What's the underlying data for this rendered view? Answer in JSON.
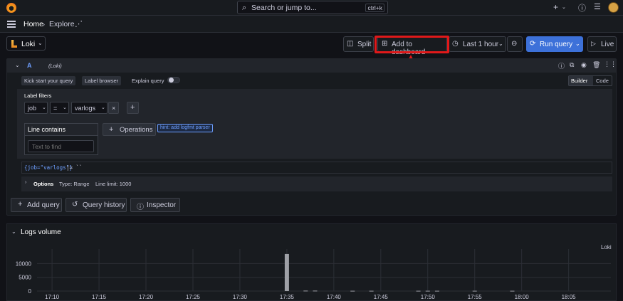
{
  "topbar": {
    "search_placeholder": "Search or jump to...",
    "search_shortcut": "ctrl+k",
    "plus_icon": "plus-icon",
    "help_icon": "help-icon",
    "news_icon": "rss-icon"
  },
  "breadcrumb": {
    "home": "Home",
    "explore": "Explore"
  },
  "toolbar": {
    "datasource": "Loki",
    "split": "Split",
    "add_to_dashboard": "Add to dashboard",
    "time_range": "Last 1 hour",
    "run_query": "Run query",
    "live": "Live"
  },
  "query": {
    "ref_id": "A",
    "datasource_label": "(Loki)",
    "kick_start": "Kick start your query",
    "label_browser": "Label browser",
    "explain_query": "Explain query",
    "mode_builder": "Builder",
    "mode_code": "Code",
    "label_filters_title": "Label filters",
    "filter_label": "job",
    "filter_op": "=",
    "filter_value": "varlogs",
    "line_contains_title": "Line contains",
    "line_contains_placeholder": "Text to find",
    "operations": "Operations",
    "hint": "hint: add logfmt parser",
    "raw_query_1": "{job=\"varlogs\"}",
    "raw_query_2": " |= ``",
    "options_title": "Options",
    "options_type": "Type: Range",
    "options_limit": "Line limit: 1000"
  },
  "bottom_buttons": {
    "add_query": "Add query",
    "query_history": "Query history",
    "inspector": "Inspector"
  },
  "logs_volume": {
    "title": "Logs volume",
    "legend": "Loki"
  },
  "chart_data": {
    "type": "bar",
    "title": "Logs volume",
    "categories": [
      "17:10",
      "17:15",
      "17:20",
      "17:25",
      "17:30",
      "17:35",
      "17:40",
      "17:45",
      "17:50",
      "17:55",
      "18:00",
      "18:05"
    ],
    "yticks": [
      "10000",
      "5000",
      "0"
    ],
    "ylim": [
      0,
      14000
    ],
    "series": [
      {
        "name": "Loki",
        "points": [
          {
            "t": "17:35",
            "value": 13500
          },
          {
            "t": "17:37",
            "value": 150
          },
          {
            "t": "17:38",
            "value": 150
          },
          {
            "t": "17:42",
            "value": 100
          },
          {
            "t": "17:44",
            "value": 100
          },
          {
            "t": "17:49",
            "value": 100
          },
          {
            "t": "17:50",
            "value": 100
          },
          {
            "t": "17:51",
            "value": 100
          },
          {
            "t": "17:55",
            "value": 100
          },
          {
            "t": "17:59",
            "value": 100
          }
        ]
      }
    ],
    "grid": true,
    "legend_position": "top-right",
    "colors": {
      "bar": "#9ea0a6",
      "grid": "#2c2f36"
    }
  },
  "colors": {
    "highlight": "#e0191a",
    "run_button": "#3d71d9",
    "hint": "#6e9fff"
  }
}
